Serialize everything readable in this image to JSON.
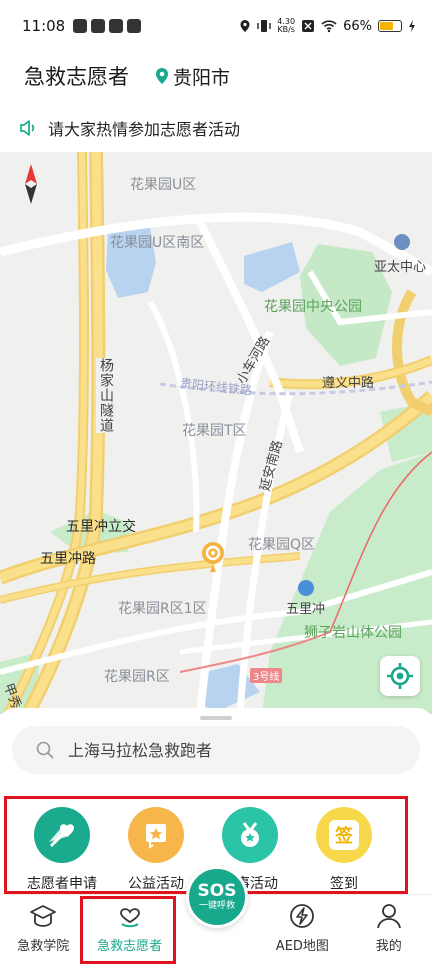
{
  "status_bar": {
    "time": "11:08",
    "net_speed_value": "4.30",
    "net_speed_unit": "KB/s",
    "battery": "66%",
    "battery_level": 0.66
  },
  "header": {
    "title": "急救志愿者",
    "city": "贵阳市"
  },
  "notice": {
    "text": "请大家热情参加志愿者活动"
  },
  "map": {
    "labels": {
      "u_zone": "花果园U区",
      "u_south": "花果园U区南区",
      "yatai": "亚太中心",
      "central_park": "花果园中央公园",
      "xiaoche_road": "小车河路",
      "zunyi_road": "遵义中路",
      "rail_line": "贵阳环线铁路",
      "t_zone": "花果园T区",
      "yanan_road": "延安南路",
      "tunnel": "杨家山隧道",
      "wulichong_interchange": "五里冲立交",
      "wulichong_road": "五里冲路",
      "q_zone": "花果园Q区",
      "wulichong_station": "五里冲",
      "shiziyan_park": "狮子岩山体公园",
      "r1_zone": "花果园R区1区",
      "r_zone": "花果园R区",
      "line3": "3号线",
      "tian_road": "甲秀"
    }
  },
  "search": {
    "placeholder": "上海马拉松急救跑者"
  },
  "features": [
    {
      "label": "志愿者申请",
      "color": "#1aaa8e",
      "icon": "hands-heart-icon"
    },
    {
      "label": "公益活动",
      "color": "#f7b64a",
      "icon": "star-flag-icon"
    },
    {
      "label": "赛事活动",
      "color": "#2bc4a6",
      "icon": "medal-icon"
    },
    {
      "label": "签到",
      "color": "#f7d84a",
      "icon": "checkin-icon",
      "text": "签"
    }
  ],
  "tabs": [
    {
      "label": "急救学院",
      "icon": "graduation-cap-icon"
    },
    {
      "label": "急救志愿者",
      "icon": "heart-smile-icon",
      "active": true
    },
    {
      "label": "",
      "icon": "sos-icon"
    },
    {
      "label": "AED地图",
      "icon": "lightning-icon"
    },
    {
      "label": "我的",
      "icon": "person-icon"
    }
  ],
  "sos": {
    "big": "SOS",
    "small": "一键呼救"
  },
  "colors": {
    "brand_green": "#18a88c",
    "highlight_red": "#e0141e"
  }
}
